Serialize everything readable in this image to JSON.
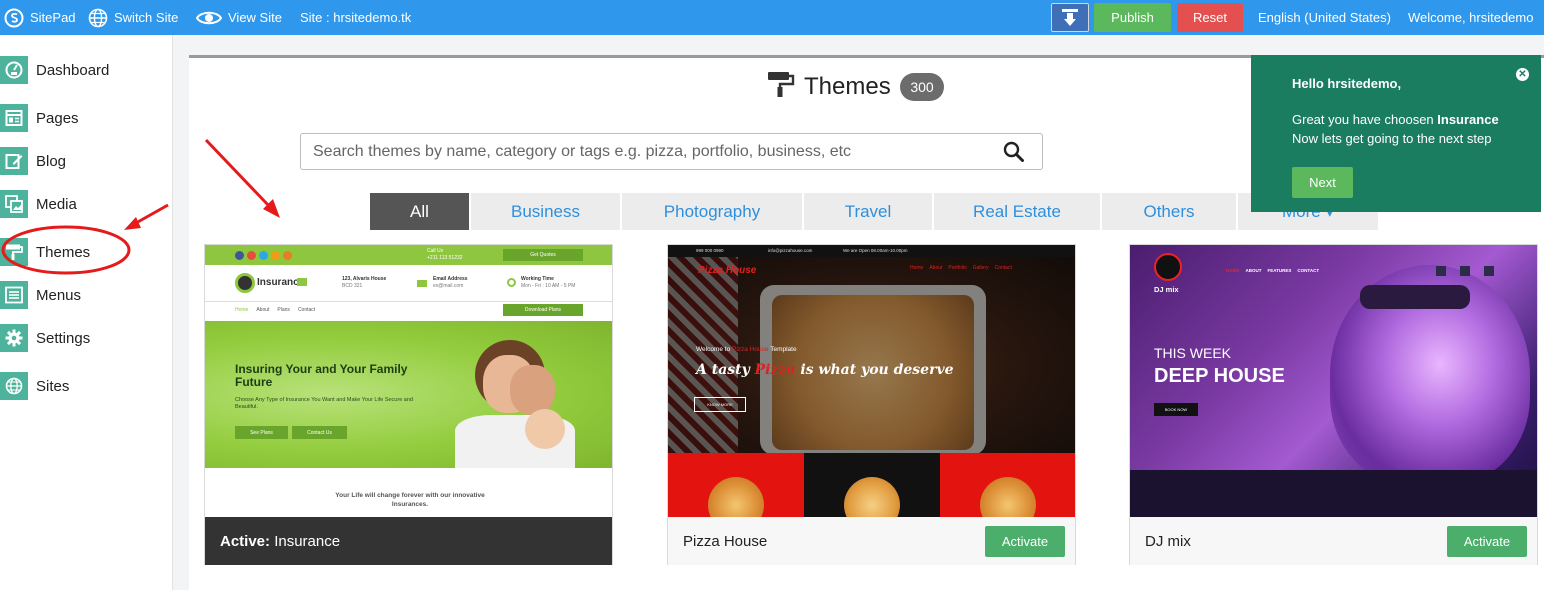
{
  "topbar": {
    "brand": "SitePad",
    "switch_site": "Switch Site",
    "view_site": "View Site",
    "site_label": "Site : hrsitedemo.tk",
    "publish": "Publish",
    "reset": "Reset",
    "language": "English (United States)",
    "welcome": "Welcome, hrsitedemo"
  },
  "sidebar": {
    "items": [
      {
        "label": "Dashboard",
        "icon": "dashboard-icon"
      },
      {
        "label": "Pages",
        "icon": "pages-icon"
      },
      {
        "label": "Blog",
        "icon": "blog-icon"
      },
      {
        "label": "Media",
        "icon": "media-icon"
      },
      {
        "label": "Themes",
        "icon": "paint-roller-icon"
      },
      {
        "label": "Menus",
        "icon": "menus-icon"
      },
      {
        "label": "Settings",
        "icon": "gear-icon"
      },
      {
        "label": "Sites",
        "icon": "globe-icon"
      }
    ]
  },
  "main": {
    "title": "Themes",
    "count": "300",
    "search_placeholder": "Search themes by name, category or tags e.g. pizza, portfolio, business, etc",
    "tabs": [
      "All",
      "Business",
      "Photography",
      "Travel",
      "Real Estate",
      "Others",
      "More ▾"
    ],
    "active_tab": "All"
  },
  "themes": [
    {
      "name": "Insurance",
      "active_prefix": "Active:",
      "thumb": {
        "contact_call": "Call Us",
        "phone": "+211 113 51232",
        "quote_btn": "Get Quotes",
        "logo": "Insurance",
        "address_label": "123, Alvaris House",
        "address_sub": "BCD 321",
        "email_label": "Email Address",
        "email_sub": "ex@mail.com",
        "time_label": "Working Time",
        "time_sub": "Mon - Fri : 10 AM - 5 PM",
        "nav": [
          "Home",
          "About",
          "Plans",
          "Contact"
        ],
        "download": "Download Plans",
        "headline": "Insuring Your and Your Family Future",
        "sub": "Choose Any Type of Insurance You Want and Make Your Life Secure and Beautiful.",
        "btn1": "See Plans",
        "btn2": "Contact Us",
        "tagline": "Your Life will change forever with our innovative Insurances."
      }
    },
    {
      "name": "Pizza House",
      "action": "Activate",
      "thumb": {
        "phone": "999 000 0990",
        "email": "info@pizzahouse.com",
        "hours": "We are Open 08.00am-10.00pm",
        "logo": "Pizza House",
        "nav": [
          "Home",
          "About",
          "Portfolio",
          "Gallery",
          "Contact"
        ],
        "welcome_prefix": "Welcome to ",
        "welcome_brand": "Pizza House",
        "welcome_suffix": " Template",
        "headline_a": "A tasty ",
        "headline_b": "Pizza",
        "headline_c": " is what you deserve",
        "btn": "KNOW MORE"
      }
    },
    {
      "name": "DJ mix",
      "action": "Activate",
      "thumb": {
        "logo": "DJ mix",
        "nav": [
          "HOME",
          "ABOUT",
          "FEATURES",
          "CONTACT"
        ],
        "line1": "THIS WEEK",
        "line2": "DEEP HOUSE",
        "btn": "BOOK NOW"
      }
    }
  ],
  "popup": {
    "greeting": "Hello hrsitedemo,",
    "line1_prefix": "Great you have choosen ",
    "line1_bold": "Insurance",
    "line2": "Now lets get going to the next step",
    "next": "Next"
  },
  "colors": {
    "topbar": "#2f97ec",
    "accent_green": "#4db39c",
    "publish": "#5cb85c",
    "reset": "#e45050",
    "popup": "#1a7d60",
    "annotation_red": "#e51b1b"
  }
}
